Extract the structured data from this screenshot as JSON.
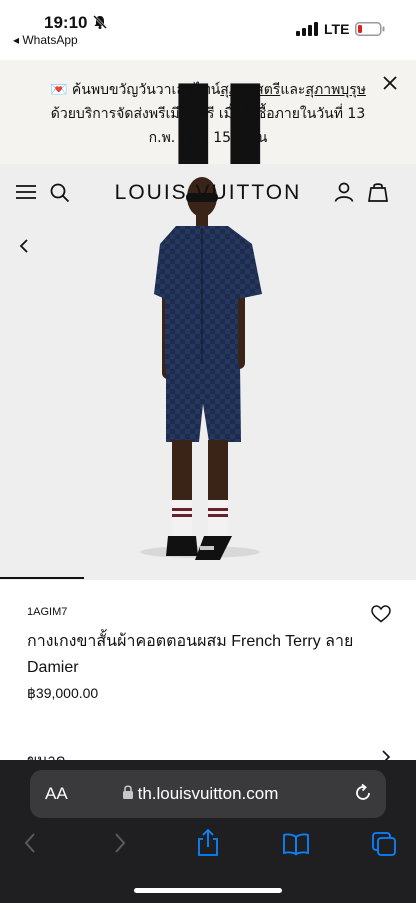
{
  "status_bar": {
    "time": "19:10",
    "back_app": "◂ WhatsApp",
    "network": "LTE"
  },
  "banner": {
    "line1_prefix": "💌 ค้นพบขวัญวันวาเลนไทน์",
    "link1": "สุภาพสตรี",
    "line1_mid": "และ",
    "link2": "สุภาพบุรุษ",
    "line2": "ด้วยบริการจัดส่งพรีเมียมฟรี เมื่อสั่งซื้อภายในวันที่ 13",
    "line3": "ก.พ. เวลา 15.00 น"
  },
  "header": {
    "logo": "LOUIS VUITTON"
  },
  "product": {
    "sku": "1AGIM7",
    "title": "กางเกงขาสั้นผ้าคอตตอนผสม French Terry ลาย Damier",
    "price": "฿39,000.00",
    "size_label": "ขนาด"
  },
  "browser": {
    "aa_label": "AA",
    "url": "th.louisvuitton.com"
  },
  "colors": {
    "banner_bg": "#f4f3ef",
    "hero_bg": "#eeeeee",
    "outfit_navy": "#1d2c4d",
    "browser_bg": "#1f1f21",
    "ios_blue": "#0a84ff"
  }
}
